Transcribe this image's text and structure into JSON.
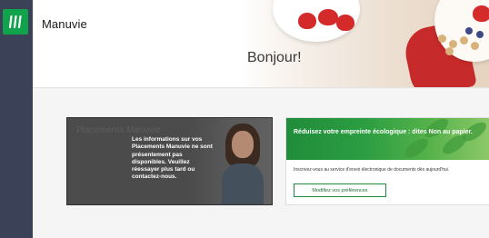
{
  "sidebar": {
    "logo_icon": "manulife-m-icon",
    "logo_color": "#10a34b",
    "background": "#3b4257"
  },
  "header": {
    "brand": "Manuvie",
    "greeting": "Bonjour!"
  },
  "cards": {
    "info": {
      "title": "Placements Manuvie",
      "message": "Les informations sur vos Placements Manuvie ne sont présentement pas disponibles. Veuillez réessayer plus tard ou contactez-nous."
    },
    "eco": {
      "title": "Réduisez votre empreinte écologique : dites Non au papier.",
      "description": "Inscrivez-vous au service d'envoi électronique de documents dès aujourd'hui.",
      "button_label": "Modifiez vos préférences",
      "accent": "#1e8a3c"
    }
  }
}
